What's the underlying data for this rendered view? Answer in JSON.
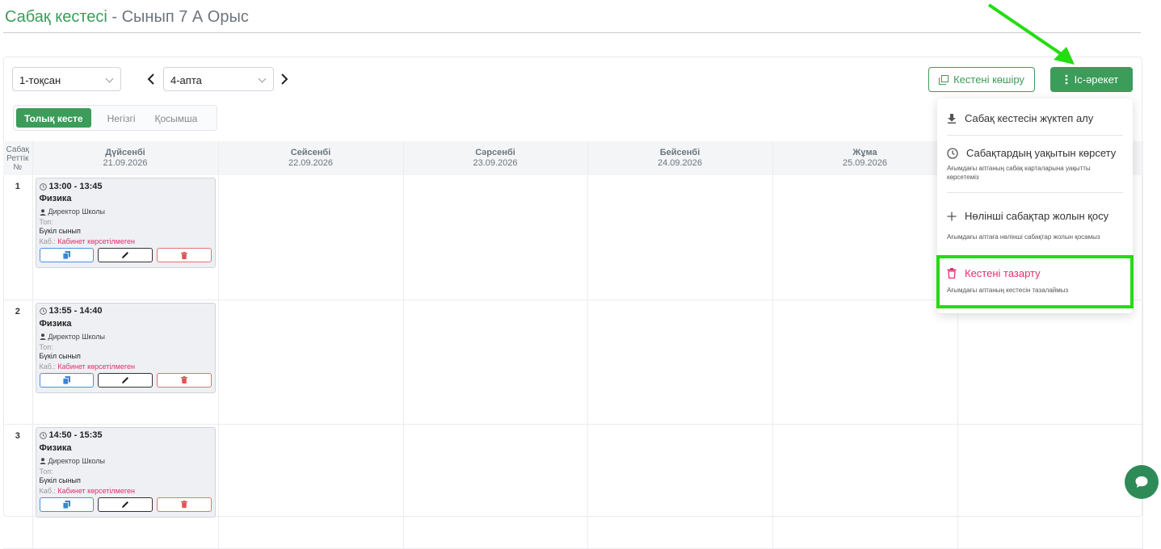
{
  "header": {
    "title_main": "Сабақ кестесі",
    "title_rest": " - Сынып 7 А Орыс"
  },
  "toolbar": {
    "quarter_select": "1-тоқсан",
    "week_select": "4-апта",
    "copy_button": "Кестені көшіру",
    "action_button": "Іс-әрекет"
  },
  "tabs": [
    {
      "label": "Толық кесте",
      "active": true
    },
    {
      "label": "Негізгі",
      "active": false
    },
    {
      "label": "Қосымша",
      "active": false
    }
  ],
  "grid": {
    "num_header": "Сабақ Реттік №",
    "days": [
      {
        "name": "Дүйсенбі",
        "date": "21.09.2026"
      },
      {
        "name": "Сейсенбі",
        "date": "22.09.2026"
      },
      {
        "name": "Сәрсенбі",
        "date": "23.09.2026"
      },
      {
        "name": "Бейсенбі",
        "date": "24.09.2026"
      },
      {
        "name": "Жұма",
        "date": "25.09.2026"
      },
      {
        "name": "",
        "date": ""
      }
    ],
    "rows": [
      {
        "num": "1",
        "lesson": {
          "time": "13:00 - 13:45",
          "subject": "Физика",
          "teacher": "Директор Школы",
          "group_label": "Топ:",
          "group": "Бүкіл сынып",
          "room_label": "Каб.:",
          "room": "Кабинет көрсетілмеген"
        }
      },
      {
        "num": "2",
        "lesson": {
          "time": "13:55 - 14:40",
          "subject": "Физика",
          "teacher": "Директор Школы",
          "group_label": "Топ:",
          "group": "Бүкіл сынып",
          "room_label": "Каб.:",
          "room": "Кабинет көрсетілмеген"
        }
      },
      {
        "num": "3",
        "lesson": {
          "time": "14:50 - 15:35",
          "subject": "Физика",
          "teacher": "Директор Школы",
          "group_label": "Топ:",
          "group": "Бүкіл сынып",
          "room_label": "Каб.:",
          "room": "Кабинет көрсетілмеген"
        }
      }
    ]
  },
  "dropdown": {
    "items": [
      {
        "label": "Сабақ кестесін жүктеп алу",
        "desc": "",
        "icon": "download-icon"
      },
      {
        "label": "Сабақтардың уақытын көрсету",
        "desc": "Ағымдағы аптаның сабақ карталарына уақытты көрсетеміз",
        "icon": "clock-icon"
      },
      {
        "label": "Нөлінші сабақтар жолын қосу",
        "desc": "Ағымдағы аптаға нөлінші сабақтар жолын қосамыз",
        "icon": "plus-icon"
      },
      {
        "label": "Кестені тазарту",
        "desc": "Ағымдағы аптаның кестесін тазалаймыз",
        "icon": "trash-icon"
      }
    ]
  },
  "colors": {
    "brand_green": "#3c9c5a",
    "danger": "#e0306a",
    "highlight": "#22dd11"
  }
}
